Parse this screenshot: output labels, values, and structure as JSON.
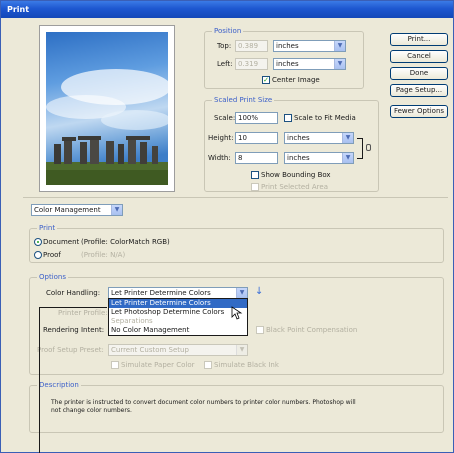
{
  "window": {
    "title": "Print"
  },
  "buttons": {
    "print": "Print...",
    "cancel": "Cancel",
    "done": "Done",
    "page_setup": "Page Setup...",
    "fewer_options": "Fewer Options"
  },
  "position": {
    "legend": "Position",
    "top_label": "Top:",
    "top_value": "0.389",
    "top_unit": "inches",
    "left_label": "Left:",
    "left_value": "0.319",
    "left_unit": "inches",
    "center_image": "Center Image"
  },
  "scaled_print_size": {
    "legend": "Scaled Print Size",
    "scale_label": "Scale:",
    "scale_value": "100%",
    "scale_to_fit": "Scale to Fit Media",
    "height_label": "Height:",
    "height_value": "10",
    "height_unit": "inches",
    "width_label": "Width:",
    "width_value": "8",
    "width_unit": "inches",
    "show_bounding_box": "Show Bounding Box",
    "print_selected_area": "Print Selected Area"
  },
  "management_select": "Color Management",
  "print_group": {
    "legend": "Print",
    "document_label": "Document",
    "document_profile": "(Profile: ColorMatch RGB)",
    "proof_label": "Proof",
    "proof_profile": "(Profile: N/A)"
  },
  "options": {
    "legend": "Options",
    "color_handling_label": "Color Handling:",
    "color_handling_value": "Let Printer Determine Colors",
    "printer_profile_label": "Printer Profile:",
    "rendering_intent_label": "Rendering Intent:",
    "black_point": "Black Point Compensation",
    "proof_setup_label": "Proof Setup Preset:",
    "proof_setup_value": "Current Custom Setup",
    "simulate_paper": "Simulate Paper Color",
    "simulate_black": "Simulate Black Ink"
  },
  "dropdown_items": [
    "Let Printer Determine Colors",
    "Let Photoshop Determine Colors",
    "Separations",
    "No Color Management"
  ],
  "description": {
    "legend": "Description",
    "text": "The printer is instructed to convert document color numbers to printer color numbers. Photoshop will not change color numbers."
  },
  "colors": {
    "title_bar": "#1d57d0",
    "highlight": "#316ac5",
    "legend": "#3b5fc9",
    "dialog_bg": "#ece9d8"
  }
}
